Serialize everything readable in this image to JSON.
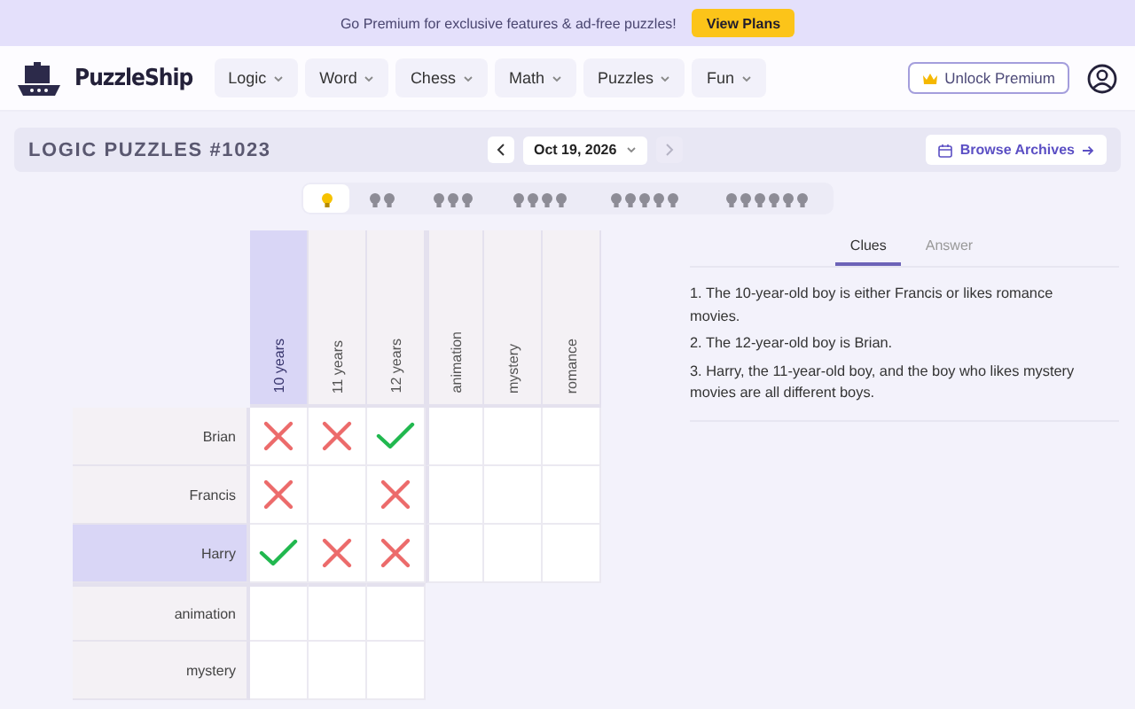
{
  "banner": {
    "text": "Go Premium for exclusive features & ad-free puzzles!",
    "button": "View Plans"
  },
  "header": {
    "logo": "PuzzleShip",
    "menus": [
      {
        "label": "Logic"
      },
      {
        "label": "Word"
      },
      {
        "label": "Chess"
      },
      {
        "label": "Math"
      },
      {
        "label": "Puzzles"
      },
      {
        "label": "Fun"
      }
    ],
    "premium_button": "Unlock Premium"
  },
  "puzzle_bar": {
    "title": "LOGIC PUZZLES #1023",
    "date": "Oct 19, 2026",
    "prev_disabled": false,
    "next_disabled": true,
    "archive_button": "Browse Archives"
  },
  "difficulty": [
    {
      "kind": "one",
      "selected": true
    },
    {
      "kind": "two",
      "selected": false
    },
    {
      "kind": "three",
      "selected": false
    },
    {
      "kind": "four",
      "selected": false
    },
    {
      "kind": "five",
      "selected": false
    },
    {
      "kind": "six",
      "selected": false
    }
  ],
  "grid": {
    "columns": [
      {
        "label": "10 years",
        "highlighted": true
      },
      {
        "label": "11 years",
        "highlighted": false
      },
      {
        "label": "12 years",
        "highlighted": false
      },
      {
        "label": "animation",
        "highlighted": false
      },
      {
        "label": "mystery",
        "highlighted": false
      },
      {
        "label": "romance",
        "highlighted": false
      }
    ],
    "rows": [
      {
        "label": "Brian",
        "highlighted": false,
        "cells": [
          {
            "kind": "cross"
          },
          {
            "kind": "cross"
          },
          {
            "kind": "check"
          },
          {
            "kind": "blank"
          },
          {
            "kind": "blank"
          },
          {
            "kind": "blank"
          }
        ]
      },
      {
        "label": "Francis",
        "highlighted": false,
        "cells": [
          {
            "kind": "cross"
          },
          {
            "kind": "blank"
          },
          {
            "kind": "cross"
          },
          {
            "kind": "blank"
          },
          {
            "kind": "blank"
          },
          {
            "kind": "blank"
          }
        ]
      },
      {
        "label": "Harry",
        "highlighted": true,
        "cells": [
          {
            "kind": "check"
          },
          {
            "kind": "cross"
          },
          {
            "kind": "cross"
          },
          {
            "kind": "blank"
          },
          {
            "kind": "blank"
          },
          {
            "kind": "blank"
          }
        ]
      },
      {
        "label": "animation",
        "highlighted": false,
        "cells": [
          {
            "kind": "blank"
          },
          {
            "kind": "blank"
          },
          {
            "kind": "blank"
          }
        ]
      },
      {
        "label": "mystery",
        "highlighted": false,
        "cells": [
          {
            "kind": "blank"
          },
          {
            "kind": "blank"
          },
          {
            "kind": "blank"
          }
        ]
      }
    ]
  },
  "tabs": [
    {
      "label": "Clues",
      "selected": true
    },
    {
      "label": "Answer",
      "selected": false
    }
  ],
  "clues": [
    "1. The 10-year-old boy is either Francis or likes romance movies.",
    "2. The 12-year-old boy is Brian.",
    "3. Harry, the 11-year-old boy, and the boy who likes mystery movies are all different boys."
  ]
}
